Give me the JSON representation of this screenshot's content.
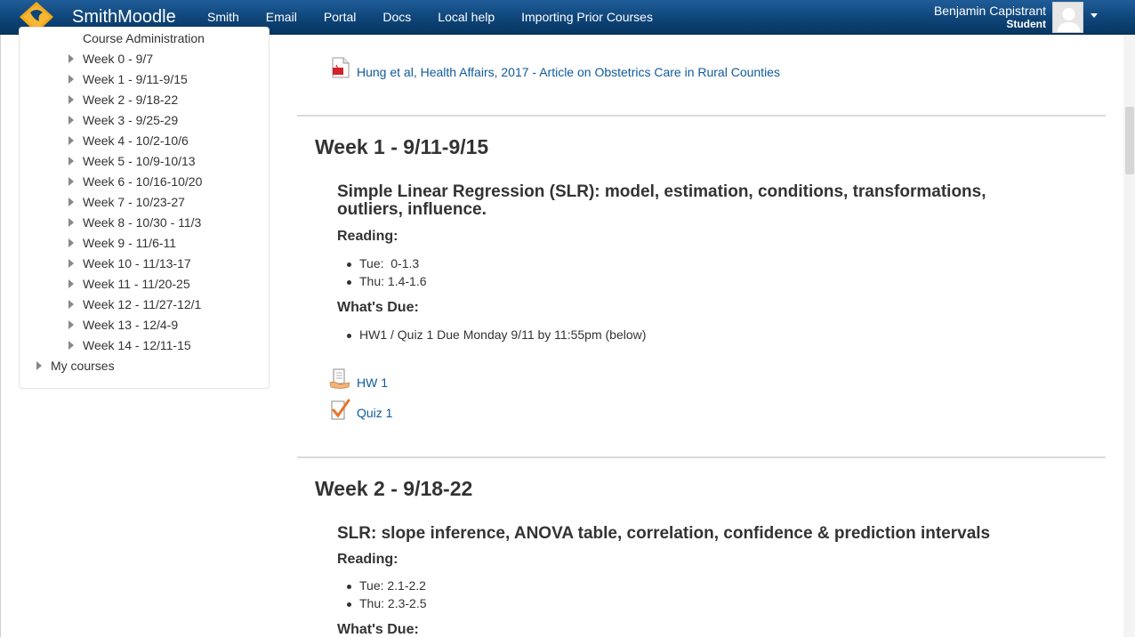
{
  "header": {
    "brand": "SmithMoodle",
    "nav": [
      "Smith",
      "Email",
      "Portal",
      "Docs",
      "Local help",
      "Importing Prior Courses"
    ],
    "user_name": "Benjamin Capistrant",
    "user_role": "Student"
  },
  "sidebar": {
    "course_admin": "Course Administration",
    "weeks": [
      "Week 0 - 9/7",
      "Week 1 - 9/11-9/15",
      "Week 2 - 9/18-22",
      "Week 3 - 9/25-29",
      "Week 4 - 10/2-10/6",
      "Week 5 - 10/9-10/13",
      "Week 6 - 10/16-10/20",
      "Week 7 - 10/23-27",
      "Week 8 - 10/30 - 11/3",
      "Week 9 - 11/6-11",
      "Week 10 - 11/13-17",
      "Week 11 - 11/20-25",
      "Week 12 - 11/27-12/1",
      "Week 13 - 12/4-9",
      "Week 14 - 12/11-15"
    ],
    "my_courses": "My courses"
  },
  "main": {
    "top_resource": "Hung et al, Health Affairs, 2017 - Article on Obstetrics Care in Rural Counties",
    "week1": {
      "title": "Week 1 - 9/11-9/15",
      "topic": "Simple Linear Regression (SLR): model, estimation, conditions, transformations, outliers, influence.",
      "reading_label": "Reading:",
      "reading": [
        "Tue:  0-1.3",
        "Thu: 1.4-1.6"
      ],
      "due_label": "What's Due:",
      "due": [
        "HW1 / Quiz 1 Due Monday 9/11 by 11:55pm (below)"
      ],
      "activities": [
        "HW 1",
        "Quiz 1"
      ]
    },
    "week2": {
      "title": "Week 2 - 9/18-22",
      "topic": "SLR: slope inference, ANOVA table, correlation, confidence & prediction intervals",
      "reading_label": "Reading:",
      "reading": [
        "Tue: 2.1-2.2",
        "Thu: 2.3-2.5"
      ],
      "due_label": "What's Due:"
    }
  },
  "colors": {
    "navbar": "#0e4478",
    "link": "#0f5a9c",
    "text": "#333333"
  }
}
